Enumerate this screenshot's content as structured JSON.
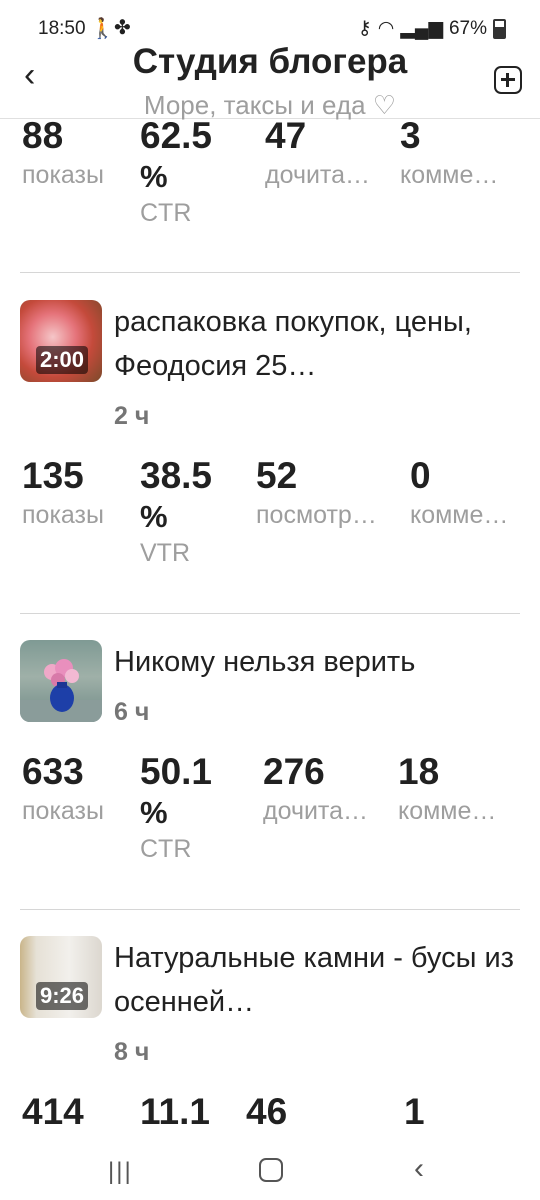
{
  "status_bar": {
    "time": "18:50",
    "battery": "67%",
    "icons": [
      "walking-icon",
      "fan-icon",
      "key-icon",
      "wifi-icon",
      "signal-icon",
      "battery-icon"
    ]
  },
  "header": {
    "title": "Студия блогера",
    "subtitle": "Море, таксы и еда ♡",
    "back_icon": "‹",
    "add_icon": "plus-square-icon"
  },
  "top_stats": {
    "impressions": "88",
    "impressions_label": "показы",
    "rate": "62.5",
    "rate_pct": "%",
    "rate_label": "CTR",
    "reads": "47",
    "reads_label": "дочита…",
    "comments": "3",
    "comments_label": "комме…"
  },
  "posts": [
    {
      "title": "распаковка покупок, цены, Феодосия 25…",
      "duration": "2:00",
      "age": "2 ч",
      "stats": {
        "impressions": "135",
        "impressions_label": "показы",
        "rate": "38.5",
        "rate_pct": "%",
        "rate_label": "VTR",
        "views": "52",
        "views_label": "посмотр…",
        "comments": "0",
        "comments_label": "комме…"
      }
    },
    {
      "title": "Никому нельзя верить",
      "age": "6 ч",
      "stats": {
        "impressions": "633",
        "impressions_label": "показы",
        "rate": "50.1",
        "rate_pct": "%",
        "rate_label": "CTR",
        "reads": "276",
        "reads_label": "дочита…",
        "comments": "18",
        "comments_label": "комме…"
      }
    },
    {
      "title": "Натуральные камни - бусы из осенней…",
      "duration": "9:26",
      "age": "8 ч",
      "stats": {
        "impressions": "414",
        "rate": "11.1",
        "views": "46",
        "comments": "1"
      }
    }
  ],
  "colors": {
    "text": "#212121",
    "secondary": "#9e9e9e",
    "divider": "#d6d6d6",
    "background": "#ffffff"
  }
}
